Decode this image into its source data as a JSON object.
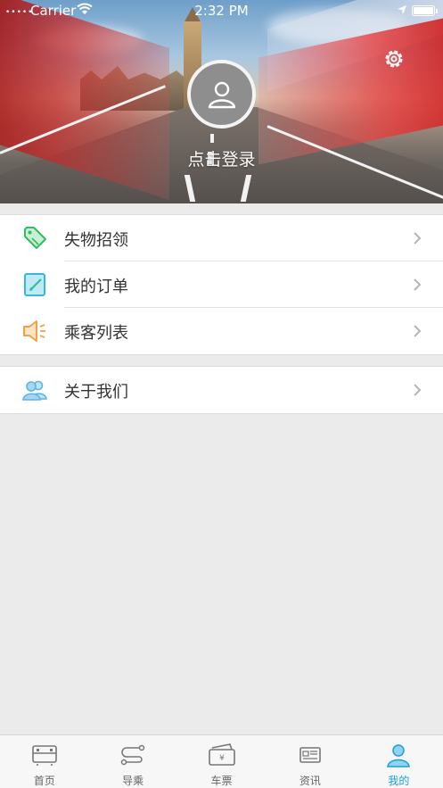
{
  "status_bar": {
    "carrier": "Carrier",
    "time": "2:32 PM",
    "signal": "•••••"
  },
  "header": {
    "login_text": "点击登录",
    "settings_icon": "gear-icon",
    "avatar_icon": "user-icon"
  },
  "menu": {
    "group1": [
      {
        "label": "失物招领",
        "icon": "tag-icon",
        "color": "#2fbf5f"
      },
      {
        "label": "我的订单",
        "icon": "edit-icon",
        "color": "#37b6d9"
      },
      {
        "label": "乘客列表",
        "icon": "speaker-icon",
        "color": "#f0a24a"
      }
    ],
    "group2": [
      {
        "label": "关于我们",
        "icon": "people-icon",
        "color": "#5bb4e6"
      }
    ]
  },
  "tabbar": {
    "tabs": [
      {
        "label": "首页",
        "icon": "bus-icon",
        "active": false
      },
      {
        "label": "导乘",
        "icon": "route-icon",
        "active": false
      },
      {
        "label": "车票",
        "icon": "ticket-icon",
        "active": false
      },
      {
        "label": "资讯",
        "icon": "news-icon",
        "active": false
      },
      {
        "label": "我的",
        "icon": "person-icon",
        "active": true
      }
    ],
    "active_color": "#1a9fd8",
    "inactive_color": "#666666"
  }
}
